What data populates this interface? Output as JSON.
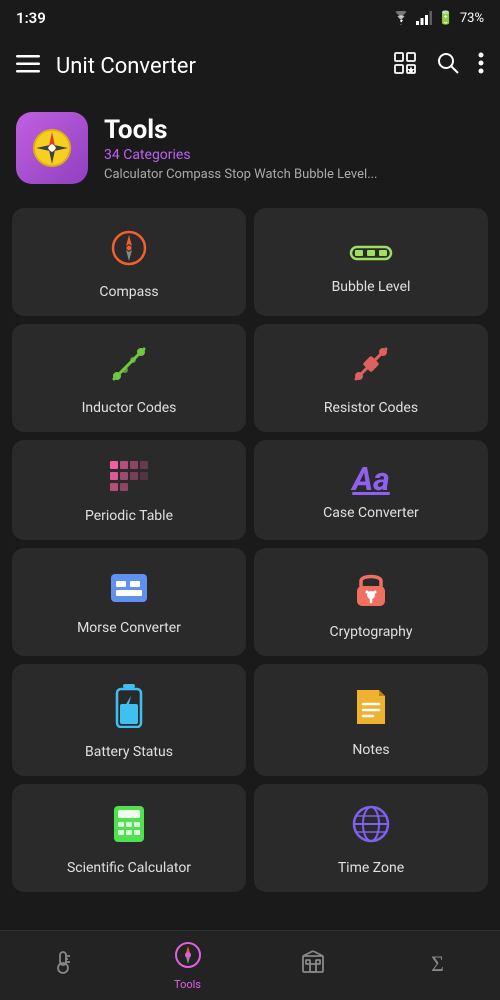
{
  "statusBar": {
    "time": "1:39",
    "batteryPercent": "73%"
  },
  "appBar": {
    "title": "Unit Converter",
    "menuIcon": "menu-icon",
    "gridStarIcon": "grid-star-icon",
    "searchIcon": "search-icon",
    "moreIcon": "more-vertical-icon"
  },
  "headerCard": {
    "icon": "🧭",
    "title": "Tools",
    "subtitle": "34 Categories",
    "description": "Calculator Compass Stop Watch Bubble Level..."
  },
  "grid": {
    "items": [
      {
        "id": "compass",
        "label": "Compass",
        "iconClass": "icon-compass",
        "icon": "⊕"
      },
      {
        "id": "bubble-level",
        "label": "Bubble Level",
        "iconClass": "icon-bubble",
        "icon": "▬▬▬"
      },
      {
        "id": "inductor-codes",
        "label": "Inductor Codes",
        "iconClass": "icon-inductor",
        "icon": "⌁"
      },
      {
        "id": "resistor-codes",
        "label": "Resistor Codes",
        "iconClass": "icon-resistor",
        "icon": "⌁"
      },
      {
        "id": "periodic-table",
        "label": "Periodic Table",
        "iconClass": "icon-periodic",
        "icon": "⊞"
      },
      {
        "id": "case-converter",
        "label": "Case Converter",
        "iconClass": "icon-case",
        "icon": "Aa"
      },
      {
        "id": "morse-converter",
        "label": "Morse Converter",
        "iconClass": "icon-morse",
        "icon": "⊟"
      },
      {
        "id": "cryptography",
        "label": "Cryptography",
        "iconClass": "icon-crypto",
        "icon": "🔒"
      },
      {
        "id": "battery-status",
        "label": "Battery Status",
        "iconClass": "icon-battery",
        "icon": "🔋"
      },
      {
        "id": "notes",
        "label": "Notes",
        "iconClass": "icon-notes",
        "icon": "📄"
      },
      {
        "id": "scientific-calculator",
        "label": "Scientific Calculator",
        "iconClass": "icon-calc",
        "icon": "⊞"
      },
      {
        "id": "time-zone",
        "label": "Time Zone",
        "iconClass": "icon-timezone",
        "icon": "🌐"
      }
    ]
  },
  "bottomNav": {
    "items": [
      {
        "id": "temperature",
        "label": "",
        "icon": "thermometer-icon",
        "active": false
      },
      {
        "id": "tools",
        "label": "Tools",
        "icon": "compass-nav-icon",
        "active": true
      },
      {
        "id": "converter",
        "label": "",
        "icon": "building-icon",
        "active": false
      },
      {
        "id": "sum",
        "label": "",
        "icon": "sigma-icon",
        "active": false
      }
    ]
  }
}
